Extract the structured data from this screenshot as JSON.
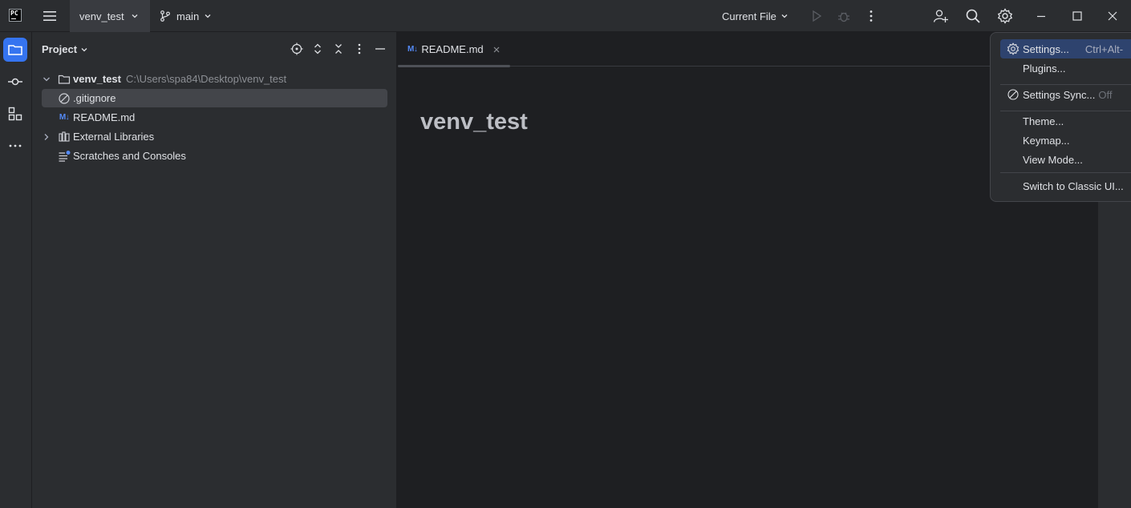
{
  "titlebar": {
    "logo_text": "PC",
    "project_name": "venv_test",
    "branch_name": "main",
    "run_config": "Current File"
  },
  "project_panel": {
    "title": "Project",
    "tree": [
      {
        "label": "venv_test",
        "path": "C:\\Users\\spa84\\Desktop\\venv_test",
        "type": "folder",
        "expanded": true
      },
      {
        "label": ".gitignore",
        "type": "ignored-file",
        "selected": true
      },
      {
        "label": "README.md",
        "type": "markdown-file",
        "badge": "M↓"
      },
      {
        "label": "External Libraries",
        "type": "library",
        "expanded": false
      },
      {
        "label": "Scratches and Consoles",
        "type": "scratches"
      }
    ]
  },
  "editor": {
    "tab_badge": "M↓",
    "tab_label": "README.md",
    "heading": "venv_test"
  },
  "settings_menu": {
    "items": [
      {
        "label": "Settings...",
        "shortcut": "Ctrl+Alt-",
        "icon": "gear-icon",
        "highlighted": true
      },
      {
        "label": "Plugins..."
      },
      {
        "label": "Settings Sync...",
        "suffix": "Off",
        "icon": "sync-off-icon"
      },
      {
        "label": "Theme..."
      },
      {
        "label": "Keymap..."
      },
      {
        "label": "View Mode..."
      },
      {
        "label": "Switch to Classic UI..."
      }
    ]
  },
  "colors": {
    "accent": "#3574f0",
    "panel_bg": "#2b2d30",
    "editor_bg": "#1e1f22",
    "selection": "#43454a",
    "menu_highlight": "#2e436e",
    "markdown_badge": "#548af7"
  }
}
